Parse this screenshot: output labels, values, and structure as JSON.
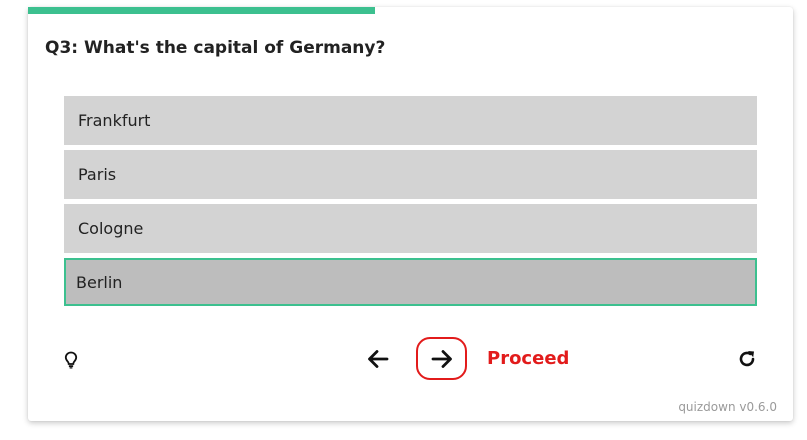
{
  "quiz": {
    "progress_fraction": 0.454,
    "accent_color": "#3cc08f",
    "question": "Q3: What's the capital of Germany?",
    "options": [
      {
        "label": "Frankfurt",
        "selected": false
      },
      {
        "label": "Paris",
        "selected": false
      },
      {
        "label": "Cologne",
        "selected": false
      },
      {
        "label": "Berlin",
        "selected": true
      }
    ]
  },
  "controls": {
    "hint_icon": "lightbulb-icon",
    "prev_icon": "arrow-left-icon",
    "next_icon": "arrow-right-icon",
    "proceed_label": "Proceed",
    "proceed_color": "#e21b1b",
    "reset_icon": "reset-icon"
  },
  "footer": {
    "version": "quizdown v0.6.0"
  }
}
